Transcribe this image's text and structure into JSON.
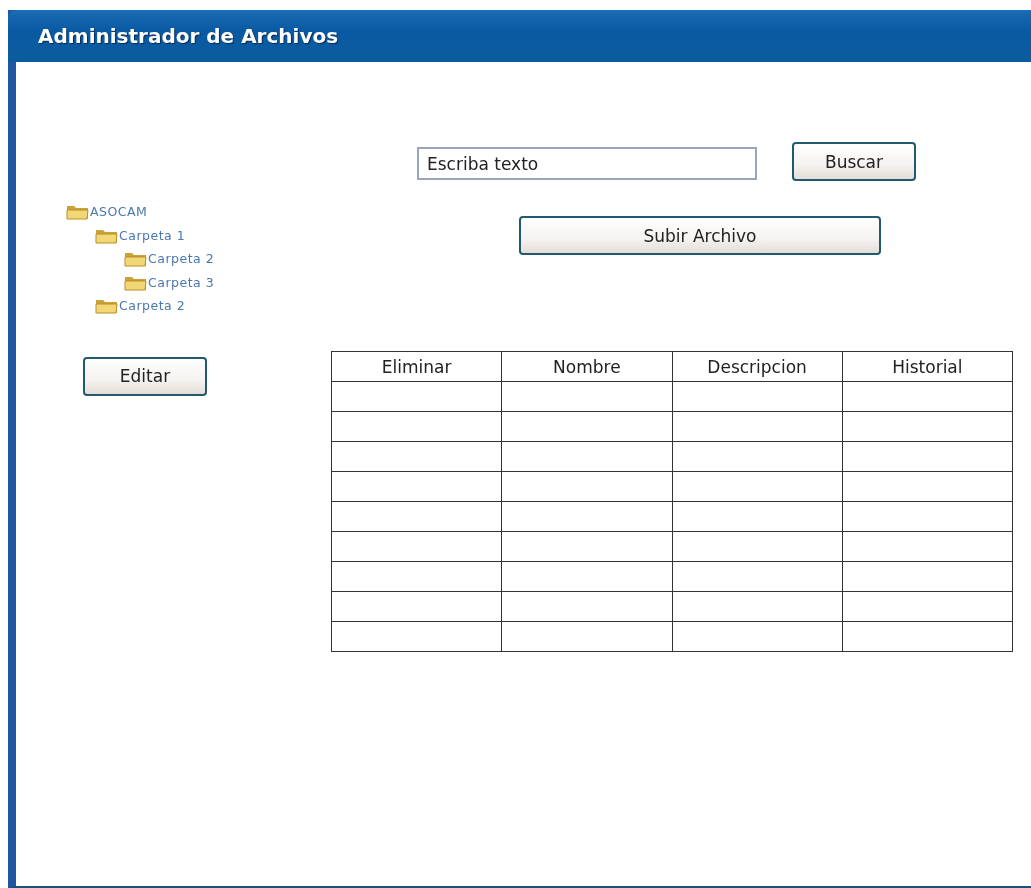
{
  "window": {
    "title": "Administrador de Archivos"
  },
  "tree": [
    {
      "label": "ASOCAM",
      "children": [
        {
          "label": "Carpeta 1",
          "children": [
            {
              "label": "Carpeta 2"
            },
            {
              "label": "Carpeta 3"
            }
          ]
        },
        {
          "label": "Carpeta 2"
        }
      ]
    }
  ],
  "edit_button": "Editar",
  "search": {
    "value": "Escriba texto",
    "button": "Buscar"
  },
  "upload_button": "Subir Archivo",
  "table": {
    "columns": [
      "Eliminar",
      "Nombre",
      "Descripcion",
      "Historial"
    ]
  }
}
